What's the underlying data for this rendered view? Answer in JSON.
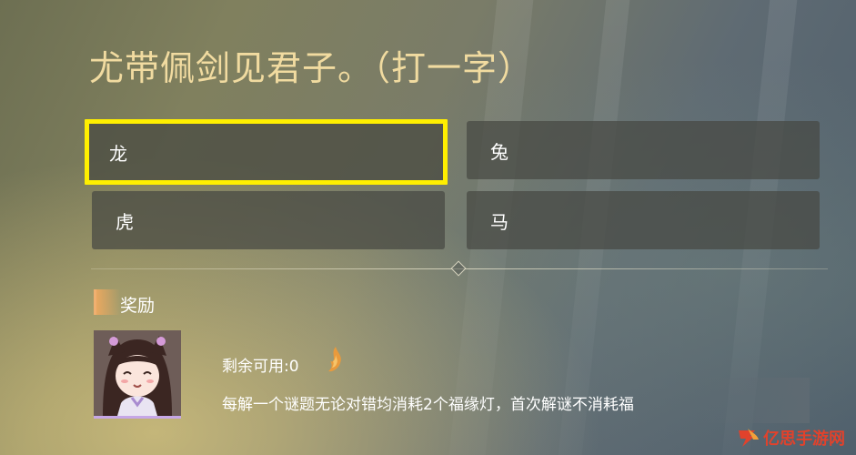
{
  "question": "尤带佩剑见君子。（打一字）",
  "options": [
    {
      "label": "龙",
      "selected": true
    },
    {
      "label": "兔",
      "selected": false
    },
    {
      "label": "虎",
      "selected": false
    },
    {
      "label": "马",
      "selected": false
    }
  ],
  "reward": {
    "title": "奖励",
    "remaining": "剩余可用:0",
    "description": "每解一个谜题无论对错均消耗2个福缘灯，首次解谜不消耗福"
  },
  "watermark": {
    "text": "亿思手游网",
    "icon": "flame-logo-icon"
  },
  "colors": {
    "question_text": "#f1dba0",
    "selection_border": "#ffef00",
    "reward_accent": "#e9a860",
    "watermark_red": "#e1422c"
  },
  "icons": {
    "resource": "flame-icon",
    "divider": "diamond-divider-icon"
  }
}
